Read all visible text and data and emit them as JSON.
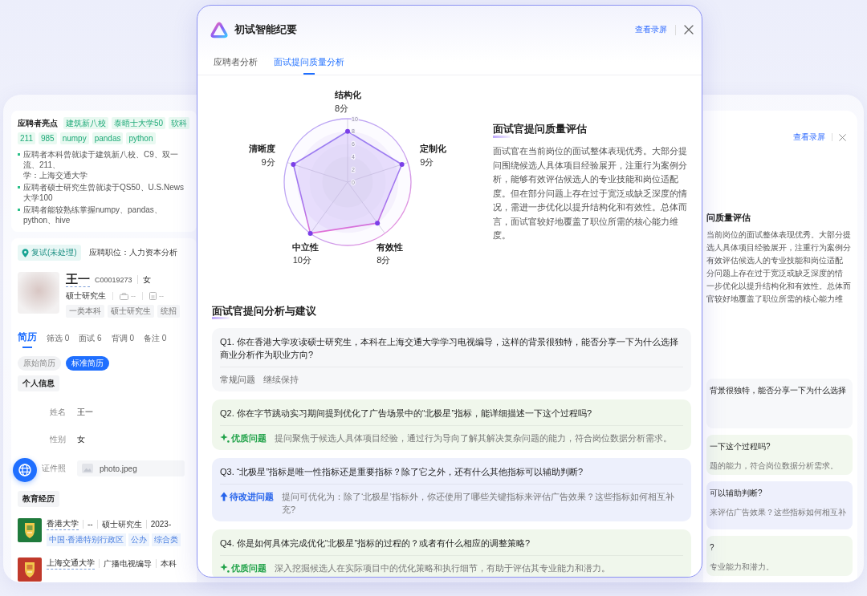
{
  "background": {
    "highlights": {
      "title": "应聘者亮点",
      "tags": [
        "建筑新八校",
        "泰晤士大学50",
        "软科",
        "211",
        "985",
        "numpy",
        "pandas",
        "python"
      ],
      "bullets": [
        {
          "lines": [
            "应聘者本科曾就读于建筑新八校、C9、双一流、211、",
            "学：上海交通大学"
          ]
        },
        {
          "lines": [
            "应聘者硕士研究生曾就读于QS50、U.S.News大学100"
          ]
        },
        {
          "lines": [
            "应聘者能较熟练掌握numpy、pandas、python、hive"
          ]
        }
      ]
    },
    "candidate": {
      "stage": "复试(未处理)",
      "position": "应聘职位：人力资本分析",
      "name": "王一",
      "code": "C00019273",
      "gender": "女",
      "degree": "硕士研究生",
      "meta": [
        {
          "kind": "work",
          "text": "--"
        },
        {
          "kind": "file",
          "text": "--"
        }
      ],
      "tags": [
        "一类本科",
        "硕士研究生",
        "统招"
      ],
      "tabs": [
        {
          "label": "简历",
          "selected": true
        },
        {
          "label": "筛选 0",
          "selected": false
        },
        {
          "label": "面试 6",
          "selected": false
        },
        {
          "label": "背调 0",
          "selected": false
        },
        {
          "label": "备注 0",
          "selected": false
        }
      ],
      "resume_versions": [
        {
          "label": "原始简历",
          "selected": false
        },
        {
          "label": "标准简历",
          "selected": true
        }
      ],
      "personal_info": {
        "title": "个人信息",
        "fields": [
          {
            "kind": "text",
            "label": "姓名",
            "value": "王一"
          },
          {
            "kind": "text",
            "label": "性别",
            "value": "女"
          },
          {
            "kind": "file",
            "label": "证件照",
            "value": "photo.jpeg"
          }
        ]
      },
      "education": {
        "title": "教育经历",
        "entries": [
          {
            "school": "香港大学",
            "details": [
              "--",
              "硕士研究生",
              "2023-"
            ],
            "tags": [
              "中国·香港特别行政区",
              "公办",
              "综合类"
            ],
            "color": "#1f7a3c"
          },
          {
            "school": "上海交通大学",
            "details": [
              "广播电视编导",
              "本科"
            ],
            "color": "#c0392b"
          }
        ]
      }
    },
    "summary_copy": {
      "link": "查看录屏",
      "heading": "问质量评估",
      "lines": [
        "当前岗位的面试整体表现优秀。大部分提",
        "选人具体项目经验展开，注重行为案例分",
        "有效评估候选人的专业技能和岗位适配",
        "分问题上存在过于宽泛或缺乏深度的情",
        "一步优化以提升结构化和有效性。总体而",
        "官较好地覆盖了职位所需的核心能力维"
      ],
      "cards": [
        {
          "kind": "regular",
          "lines": [
            "背景很独特，能否分享一下为什么选择"
          ]
        },
        {
          "kind": "good",
          "lines": [
            "一下这个过程吗?",
            "题的能力，符合岗位数据分析需求。"
          ]
        },
        {
          "kind": "improve",
          "lines": [
            "可以辅助判断?",
            "来评估广告效果？这些指标如何相互补"
          ]
        },
        {
          "kind": "good",
          "lines": [
            "?",
            "专业能力和潜力。"
          ]
        }
      ]
    }
  },
  "dialog": {
    "title": "初试智能纪要",
    "link": "查看录屏",
    "tabs": [
      {
        "label": "应聘者分析",
        "selected": false
      },
      {
        "label": "面试提问质量分析",
        "selected": true
      }
    ],
    "chart_data": {
      "type": "radar",
      "categories": [
        "结构化",
        "定制化",
        "有效性",
        "中立性",
        "清晰度"
      ],
      "values": [
        8,
        9,
        8,
        10,
        9
      ],
      "ylim": [
        0,
        10
      ],
      "yticks": [
        0,
        2,
        4,
        6,
        8,
        10
      ]
    },
    "score_labels": [
      "8分",
      "9分",
      "8分",
      "10分",
      "9分"
    ],
    "assessment": {
      "title": "面试官提问质量评估",
      "text": "面试官在当前岗位的面试整体表现优秀。大部分提问围绕候选人具体项目经验展开，注重行为案例分析，能够有效评估候选人的专业技能和岗位适配度。但在部分问题上存在过于宽泛或缺乏深度的情况，需进一步优化以提升结构化和有效性。总体而言，面试官较好地覆盖了职位所需的核心能力维度。"
    },
    "suggestions": {
      "title": "面试官提问分析与建议",
      "items": [
        {
          "kind": "regular",
          "question": "Q1. 你在香港大学攻读硕士研究生，本科在上海交通大学学习电视编导，这样的背景很独特，能否分享一下为什么选择商业分析作为职业方向?",
          "tag": "常规问题",
          "comment": "继续保持"
        },
        {
          "kind": "good",
          "question": "Q2. 你在字节跳动实习期间提到优化了广告场景中的“北极星”指标，能详细描述一下这个过程吗?",
          "tag": "优质问题",
          "comment": "提问聚焦于候选人具体项目经验，通过行为导向了解其解决复杂问题的能力，符合岗位数据分析需求。"
        },
        {
          "kind": "improve",
          "question": "Q3. “北极星”指标是唯一性指标还是重要指标？除了它之外，还有什么其他指标可以辅助判断?",
          "tag": "待改进问题",
          "comment": "提问可优化为：除了‘北极星’指标外，你还使用了哪些关键指标来评估广告效果？这些指标如何相互补充?"
        },
        {
          "kind": "good",
          "question": "Q4. 你是如何具体完成优化“北极星”指标的过程的？或者有什么相应的调整策略?",
          "tag": "优质问题",
          "comment": "深入挖掘候选人在实际项目中的优化策略和执行细节，有助于评估其专业能力和潜力。"
        }
      ]
    }
  }
}
